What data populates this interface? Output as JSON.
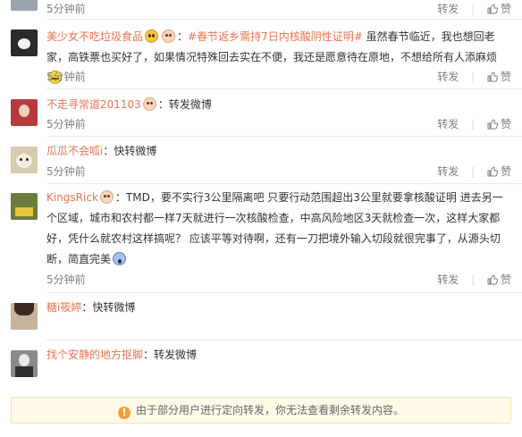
{
  "comments": [
    {
      "time": "5分钟前",
      "repost_label": "转发",
      "like_label": "赞",
      "avatar_color": "#9aa3b0"
    },
    {
      "user": "美少女不吃垃圾食品",
      "hashtag": "#春节返乡需持7日内核酸阴性证明#",
      "text": "虽然春节临近，我也想回老家，高铁票也买好了，如果情况特殊回去实在不便，我还是愿意待在原地，不想给所有人添麻烦",
      "time": "5分钟前",
      "repost_label": "转发",
      "like_label": "赞",
      "emojis": [
        "sad-face-emoji",
        "face-emoji",
        "snooze-emoji"
      ],
      "avatar_color": "#2b2b2b"
    },
    {
      "user": "不走寻常道201103",
      "text": "转发微博",
      "time": "5分钟前",
      "repost_label": "转发",
      "like_label": "赞",
      "avatar_color": "#b63a3a"
    },
    {
      "user": "瓜瓜不会呱i",
      "text": "快转微博",
      "time": "5分钟前",
      "repost_label": "转发",
      "like_label": "赞",
      "avatar_color": "#d9cbb0"
    },
    {
      "user": "KingsRick",
      "text": "TMD，要不实行3公里隔离吧 只要行动范围超出3公里就要拿核酸证明 进去另一个区域，城市和农村都一样7天就进行一次核酸检查，中高风险地区3天就检查一次，这样大家都好，凭什么就农村这样搞呢？ 应该平等对待啊，还有一刀把境外输入切段就很完事了，从源头切断，简直完美",
      "time": "5分钟前",
      "repost_label": "转发",
      "like_label": "赞",
      "emojis": [
        "face-emoji",
        "scream-emoji"
      ],
      "avatar_color": "#6a7d3c"
    },
    {
      "user": "糖i筱婷",
      "text": "快转微博",
      "avatar_color": "#c8b29a"
    },
    {
      "user": "找个安静的地方抠脚",
      "text": "转发微博",
      "avatar_color": "#8a8a8a"
    }
  ],
  "notice": {
    "icon": "warning-icon",
    "text": "由于部分用户进行定向转发，你无法查看剩余转发内容。"
  },
  "colors": {
    "username": "#eb7350",
    "meta": "#808080",
    "notice_bg": "#fff9e8",
    "warning": "#f3a23a"
  }
}
